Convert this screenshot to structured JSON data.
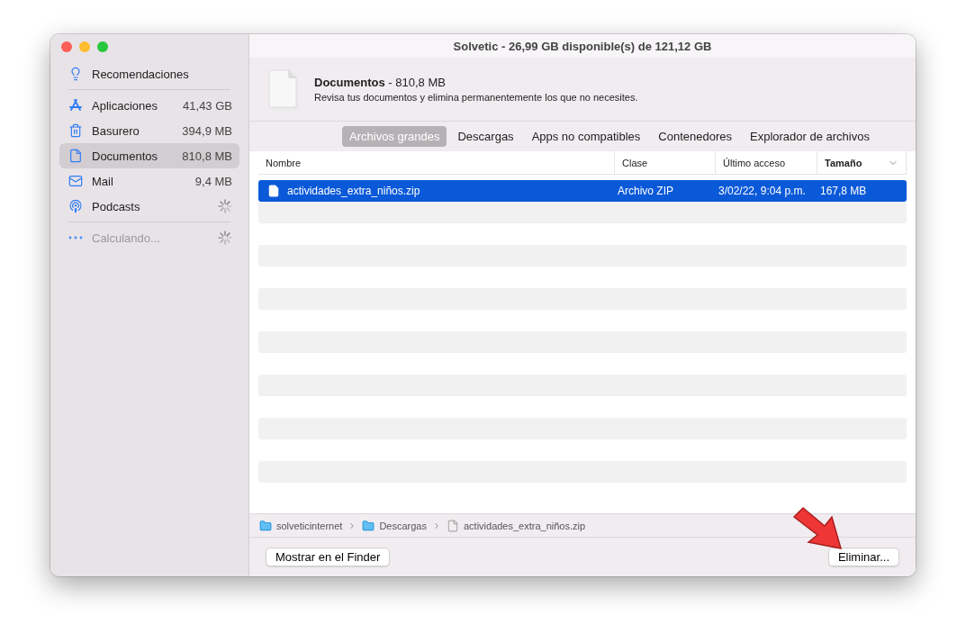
{
  "window": {
    "title": "Solvetic - 26,99 GB disponible(s) de 121,12 GB"
  },
  "sidebar": {
    "groups": [
      [
        {
          "label": "Recomendaciones",
          "selected": false,
          "loading": false,
          "disabled": false
        }
      ],
      [
        {
          "label": "Aplicaciones",
          "value": "41,43 GB",
          "selected": false,
          "loading": false,
          "disabled": false
        },
        {
          "label": "Basurero",
          "value": "394,9 MB",
          "selected": false,
          "loading": false,
          "disabled": false
        },
        {
          "label": "Documentos",
          "value": "810,8 MB",
          "selected": true,
          "loading": false,
          "disabled": false
        },
        {
          "label": "Mail",
          "value": "9,4 MB",
          "selected": false,
          "loading": false,
          "disabled": false
        },
        {
          "label": "Podcasts",
          "selected": false,
          "loading": true,
          "disabled": false
        }
      ],
      [
        {
          "label": "Calculando...",
          "selected": false,
          "loading": true,
          "disabled": true
        }
      ]
    ]
  },
  "header": {
    "title": "**Documentos** - 810,8 MB",
    "description": "Revisa tus documentos y elimina permanentemente los que no necesites."
  },
  "tabs": [
    {
      "label": "Archivos grandes",
      "selected": true
    },
    {
      "label": "Descargas",
      "selected": false
    },
    {
      "label": "Apps no compatibles",
      "selected": false
    },
    {
      "label": "Contenedores",
      "selected": false
    },
    {
      "label": "Explorador de archivos",
      "selected": false
    }
  ],
  "table": {
    "columns": [
      {
        "label": "Nombre",
        "sorted": false
      },
      {
        "label": "Clase",
        "sorted": false
      },
      {
        "label": "Último acceso",
        "sorted": false
      },
      {
        "label": "Tamaño",
        "sorted": true
      }
    ],
    "rows": [
      {
        "cells": [
          "actividades_extra_niños.zip",
          "Archivo ZIP",
          "3/02/22, 9:04 p.m.",
          "167,8 MB"
        ],
        "selected": true
      }
    ]
  },
  "path": [
    {
      "label": "solveticinternet",
      "kind": "folder"
    },
    {
      "label": "Descargas",
      "kind": "folder"
    },
    {
      "label": "actividades_extra_niños.zip",
      "kind": "file"
    }
  ],
  "buttons": {
    "left": "Mostrar en el Finder",
    "right": "Eliminar..."
  }
}
